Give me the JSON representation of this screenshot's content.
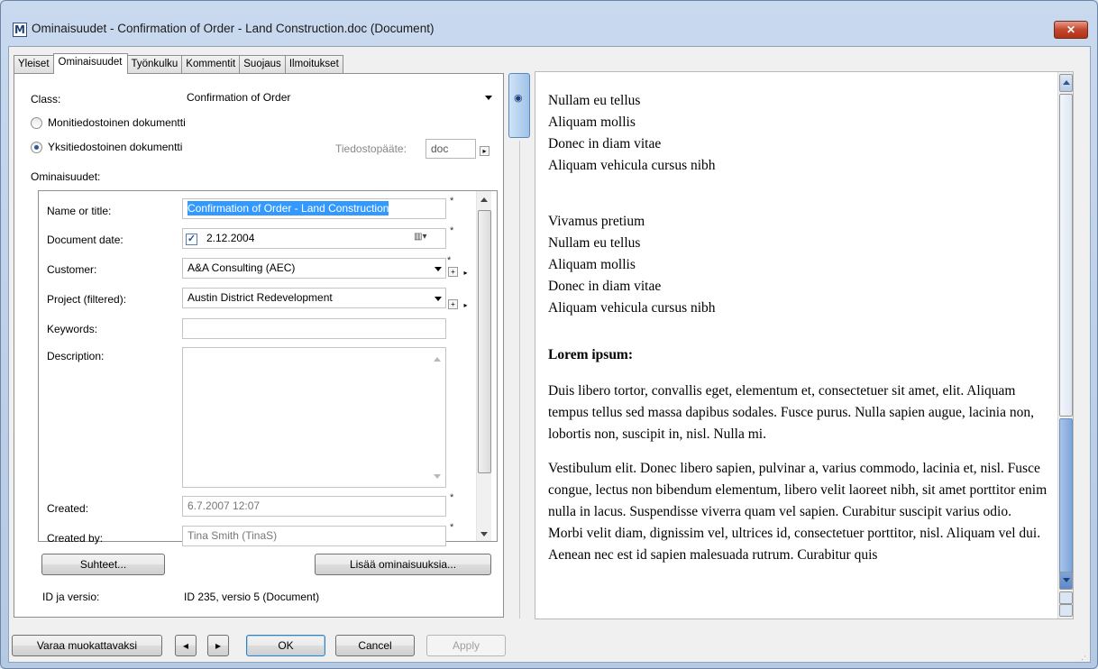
{
  "window": {
    "title": "Ominaisuudet - Confirmation of Order - Land Construction.doc (Document)",
    "app_icon": "M",
    "close_glyph": "✕"
  },
  "tabs": [
    "Yleiset",
    "Ominaisuudet",
    "Työnkulku",
    "Kommentit",
    "Suojaus",
    "Ilmoitukset"
  ],
  "active_tab": "Ominaisuudet",
  "class": {
    "label": "Class:",
    "value": "Confirmation of Order"
  },
  "radio_multi": "Monitiedostoinen dokumentti",
  "radio_single": "Yksitiedostoinen dokumentti",
  "file_ext": {
    "label": "Tiedostopääte:",
    "value": "doc"
  },
  "properties_label": "Ominaisuudet:",
  "properties": {
    "name": {
      "label": "Name or title:",
      "value": "Confirmation of Order - Land Construction"
    },
    "date": {
      "label": "Document date:",
      "value": "2.12.2004"
    },
    "customer": {
      "label": "Customer:",
      "value": "A&A Consulting (AEC)"
    },
    "project": {
      "label": "Project (filtered):",
      "value": "Austin District Redevelopment"
    },
    "keywords": {
      "label": "Keywords:",
      "value": ""
    },
    "description": {
      "label": "Description:",
      "value": ""
    },
    "created": {
      "label": "Created:",
      "value": "6.7.2007 12:07"
    },
    "created_by": {
      "label": "Created by:",
      "value": "Tina Smith (TinaS)"
    }
  },
  "required_mark": "*",
  "buttons": {
    "relations": "Suhteet...",
    "more_props": "Lisää ominaisuuksia...",
    "checkout": "Varaa muokattavaksi",
    "ok": "OK",
    "cancel": "Cancel",
    "apply": "Apply"
  },
  "id_version": {
    "label": "ID ja versio:",
    "value": "ID 235, versio 5 (Document)"
  },
  "preview": {
    "block1": [
      "Nullam eu tellus",
      "Aliquam mollis",
      "Donec in diam vitae",
      "Aliquam vehicula cursus nibh"
    ],
    "block2": [
      "Vivamus pretium",
      "Nullam eu tellus",
      "Aliquam mollis",
      "Donec in diam vitae",
      "Aliquam vehicula cursus nibh"
    ],
    "heading": "Lorem ipsum:",
    "para1": "Duis libero tortor, convallis eget, elementum et, consectetuer sit amet, elit. Aliquam tempus tellus sed massa dapibus sodales. Fusce purus. Nulla sapien augue, lacinia non, lobortis non, suscipit in, nisl. Nulla mi.",
    "para2": "Vestibulum elit. Donec libero sapien, pulvinar a, varius commodo, lacinia et, nisl. Fusce congue, lectus non bibendum elementum, libero velit laoreet nibh, sit amet porttitor enim nulla in lacus. Suspendisse viverra quam vel sapien. Curabitur suscipit varius odio. Morbi velit diam, dignissim vel, ultrices id, consectetuer porttitor, nisl. Aliquam vel dui. Aenean nec est id sapien malesuada rutrum. Curabitur quis"
  },
  "colors": {
    "selection": "#3399ff",
    "accent": "#2b5797"
  }
}
